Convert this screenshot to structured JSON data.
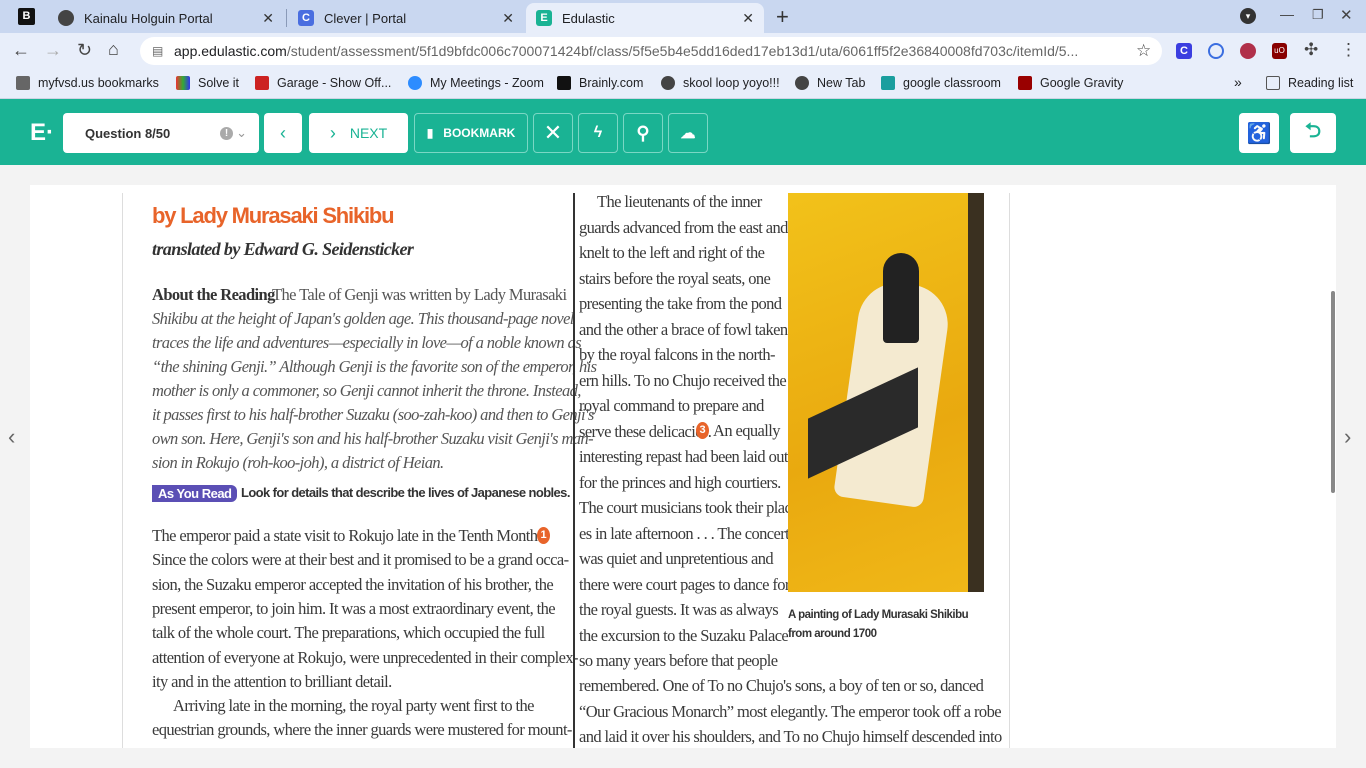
{
  "browser": {
    "tabs": [
      {
        "title": "Kainalu Holguin Portal"
      },
      {
        "title": "Clever | Portal"
      },
      {
        "title": "Edulastic",
        "active": true
      }
    ],
    "url_host": "app.edulastic.com",
    "url_path": "/student/assessment/5f1d9bfdc006c700071424bf/class/5f5e5b4e5dd16ded17eb13d1/uta/6061ff5f2e36840008fd703c/itemId/5...",
    "bookmarks": [
      "myfvsd.us bookmarks",
      "Solve it",
      "Garage - Show Off...",
      "My Meetings - Zoom",
      "Brainly.com",
      "skool loop yoyo!!!",
      "New Tab",
      "google classroom",
      "Google Gravity"
    ],
    "more": "»",
    "reading_list": "Reading list"
  },
  "toolbar": {
    "logo": "E·",
    "question": "Question 8/50",
    "next": "NEXT",
    "bookmark": "BOOKMARK"
  },
  "doc": {
    "author": "by Lady Murasaki Shikibu",
    "translator": "translated by Edward G. Seidensticker",
    "about_label": "About the Reading",
    "about_lines": [
      "The Tale of Genji was written by Lady Murasaki",
      "Shikibu at the height of Japan's golden age. This thousand-page novel",
      "traces the life and adventures—especially in love—of a noble known as",
      "“the shining Genji.” Although Genji is the favorite son of the emperor, his",
      "mother is only a commoner, so Genji cannot inherit the throne. Instead,",
      "it passes first to his half-brother Suzaku (soo-zah-koo) and then to Genji's",
      "own son. Here, Genji's son and his half-brother Suzaku visit Genji's man-",
      "sion in Rokujo (roh-koo-joh), a district of Heian."
    ],
    "as_you_read": "As You Read",
    "as_you_read_text": "Look for details that describe the lives of Japanese nobles.",
    "left_lines": [
      "The emperor paid a state visit to Rokujo late in the Tenth Month.",
      "Since the colors were at their best and it promised to be a grand occa-",
      "sion, the Suzaku emperor accepted the invitation of his brother, the",
      "present emperor, to join him. It was a most extraordinary event, the",
      "talk of the whole court. The preparations, which occupied the full",
      "attention of everyone at Rokujo, were unprecedented in their complex-",
      "ity and in the attention to brilliant detail.",
      "Arriving late in the morning, the royal party went first to the",
      "equestrian grounds, where the inner guards were mustered for mount-"
    ],
    "marker1": "1",
    "right_lines": [
      "The lieutenants of the inner",
      "guards advanced from the east and",
      "knelt to the left and right of the",
      "stairs before the royal seats, one",
      "presenting the take from the pond",
      "and the other a brace of fowl taken",
      "by the royal falcons in the north-",
      "ern hills. To no Chujo received the",
      "royal command to prepare and",
      "serve these delicacies.",
      "interesting repast had been laid out",
      "for the princes and high courtiers.",
      "The court musicians took their plac-",
      "es in late afternoon . . . The concert",
      "was quiet and unpretentious and",
      "there were court pages to dance for",
      "the royal guests. It was as always",
      "the excursion to the Suzaku Palace",
      "so many years before that people"
    ],
    "marker3": "3",
    "marker3_after": "An equally",
    "wide_lines": [
      "remembered. One of To no Chujo's sons, a boy of ten or so, danced",
      "“Our Gracious Monarch” most elegantly. The emperor took off a robe",
      "and laid it over his shoulders, and To no Chujo himself descended into"
    ],
    "caption": [
      "A painting of Lady Murasaki Shikibu",
      "from around 1700"
    ]
  },
  "colors": {
    "accent": "#1ab394",
    "title": "#e8642a",
    "badge": "#5b4fb5"
  }
}
